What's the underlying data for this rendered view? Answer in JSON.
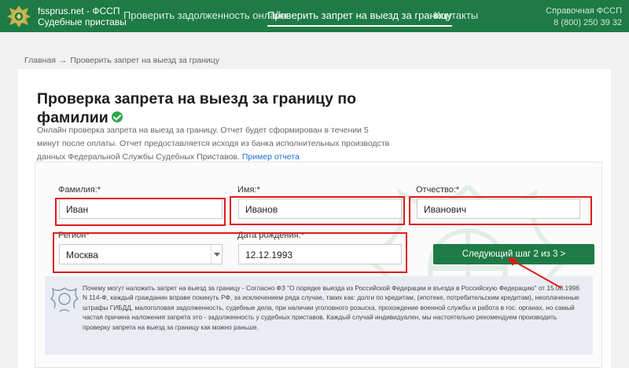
{
  "header": {
    "brand_line1": "fssprus.net - ФССП",
    "brand_line2": "Судебные приставы",
    "nav": [
      {
        "label": "Проверить задолженность онлайн",
        "active": false
      },
      {
        "label": "Проверить запрет на выезд за границу",
        "active": true
      },
      {
        "label": "Контакты",
        "active": false
      }
    ],
    "help_label": "Справочная ФССП",
    "help_phone": "8 (800) 250 39 32"
  },
  "breadcrumb": {
    "home": "Главная",
    "separator": "→",
    "current": "Проверить запрет на выезд за границу"
  },
  "page": {
    "title": "Проверка запрета на выезд за границу по фамилии",
    "description": "Онлайн проверка запрета на выезд за границу. Отчет будет сформирован в течении 5 минут после оплаты. Отчет предоставляется исходя из банка исполнительных производств данных Федеральной Службы Судебных Приставов.",
    "sample_link": "Пример отчета"
  },
  "form": {
    "surname": {
      "label": "Фамилия:*",
      "value": "Иван"
    },
    "name": {
      "label": "Имя:*",
      "value": "Иванов"
    },
    "patronymic": {
      "label": "Отчество:*",
      "value": "Иванович"
    },
    "region": {
      "label": "Регион*",
      "value": "Москва"
    },
    "birthdate": {
      "label": "Дата рождения:*",
      "value": "12.12.1993"
    },
    "next_button": "Следующий шаг 2 из 3 >"
  },
  "info": {
    "text": "Почему могут наложить запрет на выезд за границу - Согласно ФЗ \"О порядке выезда из Российской Федерации и въезда в Российскую Федерацию\" от 15.08.1996 N 114-Ф, каждый гражданин вправе покинуть РФ, за исключением ряда случае, таких как: долги по кредитам, (ипотеке, потребительским кредитам), неоплаченные штрафы ГИБДД, малоголовая задолженность, судебные дела, при наличии уголовного розыска, прохождение военной службы и работа в гос. органах, но самый частая причина наложения запрета это - задолженность у судебных приставов. Каждый случай индивидуален, мы настоятельно рекомендуем производить проверку запрета на выезд за границу как можно раньше."
  },
  "colors": {
    "brand_green": "#1e7b45",
    "annotation_red": "#e01b1b",
    "link_blue": "#1d6fd6"
  }
}
